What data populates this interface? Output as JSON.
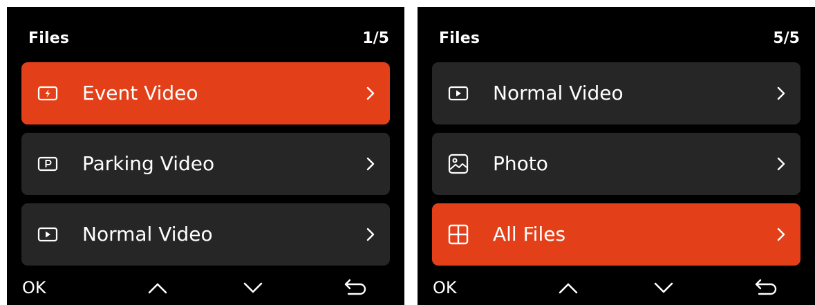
{
  "colors": {
    "accent": "#e3401a",
    "item_bg": "#262626",
    "screen_bg": "#000000",
    "text": "#ffffff"
  },
  "screens": [
    {
      "title": "Files",
      "page": "1/5",
      "items": [
        {
          "label": "Event Video",
          "icon": "event-video-icon",
          "selected": true
        },
        {
          "label": "Parking Video",
          "icon": "parking-video-icon",
          "selected": false
        },
        {
          "label": "Normal Video",
          "icon": "normal-video-icon",
          "selected": false
        }
      ],
      "footer": {
        "ok": "OK",
        "up_icon": "chevron-up-icon",
        "down_icon": "chevron-down-icon",
        "back_icon": "back-arrow-icon"
      }
    },
    {
      "title": "Files",
      "page": "5/5",
      "items": [
        {
          "label": "Normal Video",
          "icon": "normal-video-icon",
          "selected": false
        },
        {
          "label": "Photo",
          "icon": "photo-icon",
          "selected": false
        },
        {
          "label": "All Files",
          "icon": "all-files-grid-icon",
          "selected": true
        }
      ],
      "footer": {
        "ok": "OK",
        "up_icon": "chevron-up-icon",
        "down_icon": "chevron-down-icon",
        "back_icon": "back-arrow-icon"
      }
    }
  ]
}
